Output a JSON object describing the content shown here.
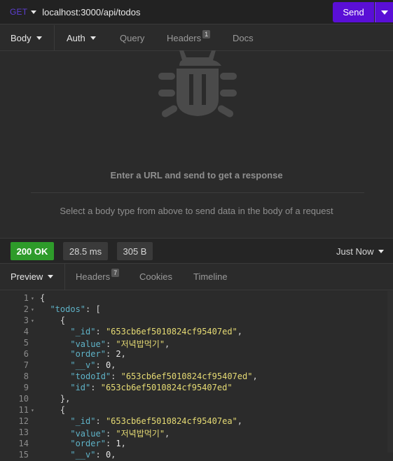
{
  "request": {
    "method": "GET",
    "url": "localhost:3000/api/todos",
    "send_label": "Send"
  },
  "request_tabs": {
    "body": "Body",
    "auth": "Auth",
    "query": "Query",
    "headers": "Headers",
    "headers_count": "1",
    "docs": "Docs"
  },
  "empty_state": {
    "title": "Enter a URL and send to get a response",
    "subtitle": "Select a body type from above to send data in the body of a request"
  },
  "status": {
    "code": "200 OK",
    "time": "28.5 ms",
    "size": "305 B",
    "history": "Just Now"
  },
  "response_tabs": {
    "preview": "Preview",
    "headers": "Headers",
    "headers_count": "7",
    "cookies": "Cookies",
    "timeline": "Timeline"
  },
  "colors": {
    "accent": "#5a0fd6",
    "status_ok": "#2e9b2a",
    "json_key": "#5fb3c8",
    "json_string": "#e6db74"
  },
  "icons": {
    "empty_state": "bug-icon"
  },
  "code_lines": [
    {
      "n": "1",
      "fold": "▾",
      "parts": [
        {
          "t": "p",
          "v": "{"
        }
      ]
    },
    {
      "n": "2",
      "fold": "▾",
      "parts": [
        {
          "t": "p",
          "v": "  "
        },
        {
          "t": "k",
          "v": "\"todos\""
        },
        {
          "t": "p",
          "v": ": ["
        }
      ]
    },
    {
      "n": "3",
      "fold": "▾",
      "parts": [
        {
          "t": "p",
          "v": "    {"
        }
      ]
    },
    {
      "n": "4",
      "fold": "",
      "parts": [
        {
          "t": "p",
          "v": "      "
        },
        {
          "t": "k",
          "v": "\"_id\""
        },
        {
          "t": "p",
          "v": ": "
        },
        {
          "t": "s",
          "v": "\"653cb6ef5010824cf95407ed\""
        },
        {
          "t": "p",
          "v": ","
        }
      ]
    },
    {
      "n": "5",
      "fold": "",
      "parts": [
        {
          "t": "p",
          "v": "      "
        },
        {
          "t": "k",
          "v": "\"value\""
        },
        {
          "t": "p",
          "v": ": "
        },
        {
          "t": "s",
          "v": "\"저녁밥먹기\""
        },
        {
          "t": "p",
          "v": ","
        }
      ]
    },
    {
      "n": "6",
      "fold": "",
      "parts": [
        {
          "t": "p",
          "v": "      "
        },
        {
          "t": "k",
          "v": "\"order\""
        },
        {
          "t": "p",
          "v": ": "
        },
        {
          "t": "n",
          "v": "2"
        },
        {
          "t": "p",
          "v": ","
        }
      ]
    },
    {
      "n": "7",
      "fold": "",
      "parts": [
        {
          "t": "p",
          "v": "      "
        },
        {
          "t": "k",
          "v": "\"__v\""
        },
        {
          "t": "p",
          "v": ": "
        },
        {
          "t": "n",
          "v": "0"
        },
        {
          "t": "p",
          "v": ","
        }
      ]
    },
    {
      "n": "8",
      "fold": "",
      "parts": [
        {
          "t": "p",
          "v": "      "
        },
        {
          "t": "k",
          "v": "\"todoId\""
        },
        {
          "t": "p",
          "v": ": "
        },
        {
          "t": "s",
          "v": "\"653cb6ef5010824cf95407ed\""
        },
        {
          "t": "p",
          "v": ","
        }
      ]
    },
    {
      "n": "9",
      "fold": "",
      "parts": [
        {
          "t": "p",
          "v": "      "
        },
        {
          "t": "k",
          "v": "\"id\""
        },
        {
          "t": "p",
          "v": ": "
        },
        {
          "t": "s",
          "v": "\"653cb6ef5010824cf95407ed\""
        }
      ]
    },
    {
      "n": "10",
      "fold": "",
      "parts": [
        {
          "t": "p",
          "v": "    },"
        }
      ]
    },
    {
      "n": "11",
      "fold": "▾",
      "parts": [
        {
          "t": "p",
          "v": "    {"
        }
      ]
    },
    {
      "n": "12",
      "fold": "",
      "parts": [
        {
          "t": "p",
          "v": "      "
        },
        {
          "t": "k",
          "v": "\"_id\""
        },
        {
          "t": "p",
          "v": ": "
        },
        {
          "t": "s",
          "v": "\"653cb6ef5010824cf95407ea\""
        },
        {
          "t": "p",
          "v": ","
        }
      ]
    },
    {
      "n": "13",
      "fold": "",
      "parts": [
        {
          "t": "p",
          "v": "      "
        },
        {
          "t": "k",
          "v": "\"value\""
        },
        {
          "t": "p",
          "v": ": "
        },
        {
          "t": "s",
          "v": "\"저녁밥먹기\""
        },
        {
          "t": "p",
          "v": ","
        }
      ]
    },
    {
      "n": "14",
      "fold": "",
      "parts": [
        {
          "t": "p",
          "v": "      "
        },
        {
          "t": "k",
          "v": "\"order\""
        },
        {
          "t": "p",
          "v": ": "
        },
        {
          "t": "n",
          "v": "1"
        },
        {
          "t": "p",
          "v": ","
        }
      ]
    },
    {
      "n": "15",
      "fold": "",
      "parts": [
        {
          "t": "p",
          "v": "      "
        },
        {
          "t": "k",
          "v": "\"__v\""
        },
        {
          "t": "p",
          "v": ": "
        },
        {
          "t": "n",
          "v": "0"
        },
        {
          "t": "p",
          "v": ","
        }
      ]
    }
  ]
}
